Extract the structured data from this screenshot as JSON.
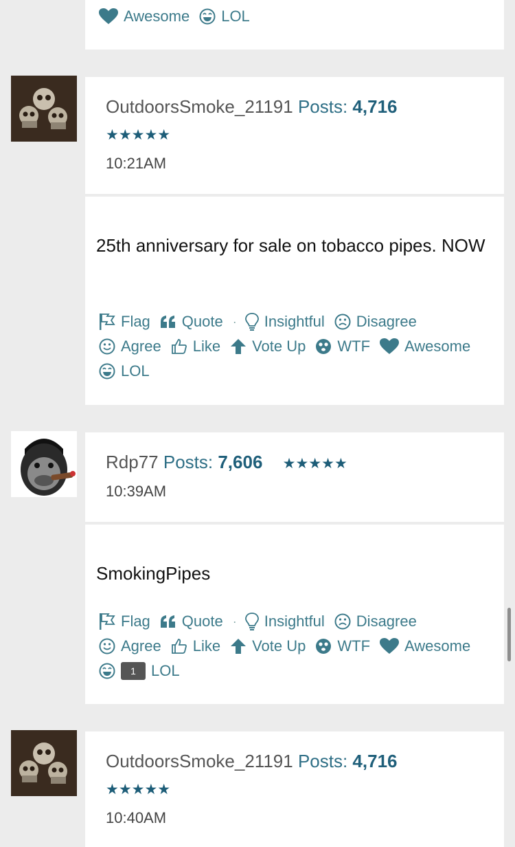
{
  "top_reactions": {
    "awesome": "Awesome",
    "lol": "LOL"
  },
  "posts": [
    {
      "username": "OutdoorsSmoke_21191",
      "posts_label": "Posts:",
      "posts_count": "4,716",
      "stars": "★★★★★",
      "time": "10:21AM",
      "body": "25th anniversary for sale on tobacco pipes. NOW",
      "reactions": {
        "flag": "Flag",
        "quote": "Quote",
        "insightful": "Insightful",
        "disagree": "Disagree",
        "agree": "Agree",
        "like": "Like",
        "vote_up": "Vote Up",
        "wtf": "WTF",
        "awesome": "Awesome",
        "lol": "LOL"
      }
    },
    {
      "username": "Rdp77",
      "posts_label": "Posts:",
      "posts_count": "7,606",
      "stars": "★★★★★",
      "time": "10:39AM",
      "body": "SmokingPipes",
      "reactions": {
        "flag": "Flag",
        "quote": "Quote",
        "insightful": "Insightful",
        "disagree": "Disagree",
        "agree": "Agree",
        "like": "Like",
        "vote_up": "Vote Up",
        "wtf": "WTF",
        "awesome": "Awesome",
        "lol": "LOL",
        "lol_count": "1"
      }
    },
    {
      "username": "OutdoorsSmoke_21191",
      "posts_label": "Posts:",
      "posts_count": "4,716",
      "stars": "★★★★★",
      "time": "10:40AM"
    }
  ],
  "colors": {
    "accent": "#3c7a8a",
    "posts_count": "#1f5f7a",
    "background": "#ececec"
  }
}
